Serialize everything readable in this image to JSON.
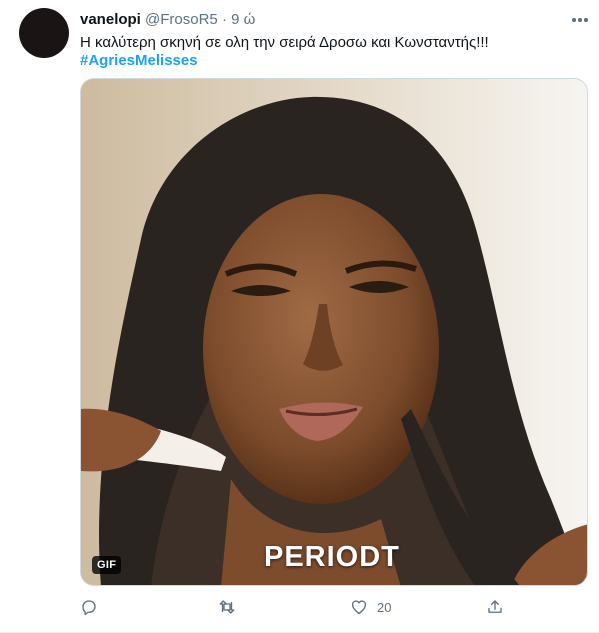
{
  "tweet": {
    "display_name": "vanelopi",
    "handle": "@FrosoR5",
    "dot": "·",
    "time": "9 ώ",
    "text": "Η καλύτερη σκηνή σε ολη την σειρά Δροσω και Κωνσταντής!!!",
    "hashtag": "#AgriesMelisses"
  },
  "media": {
    "badge": "GIF",
    "caption": "PERIODT"
  },
  "actions": {
    "reply_icon": "reply-icon",
    "retweet_icon": "retweet-icon",
    "like_icon": "heart-icon",
    "like_count": "20",
    "share_icon": "share-icon"
  },
  "colors": {
    "link": "#1da1f2",
    "secondary": "#5b7083"
  }
}
